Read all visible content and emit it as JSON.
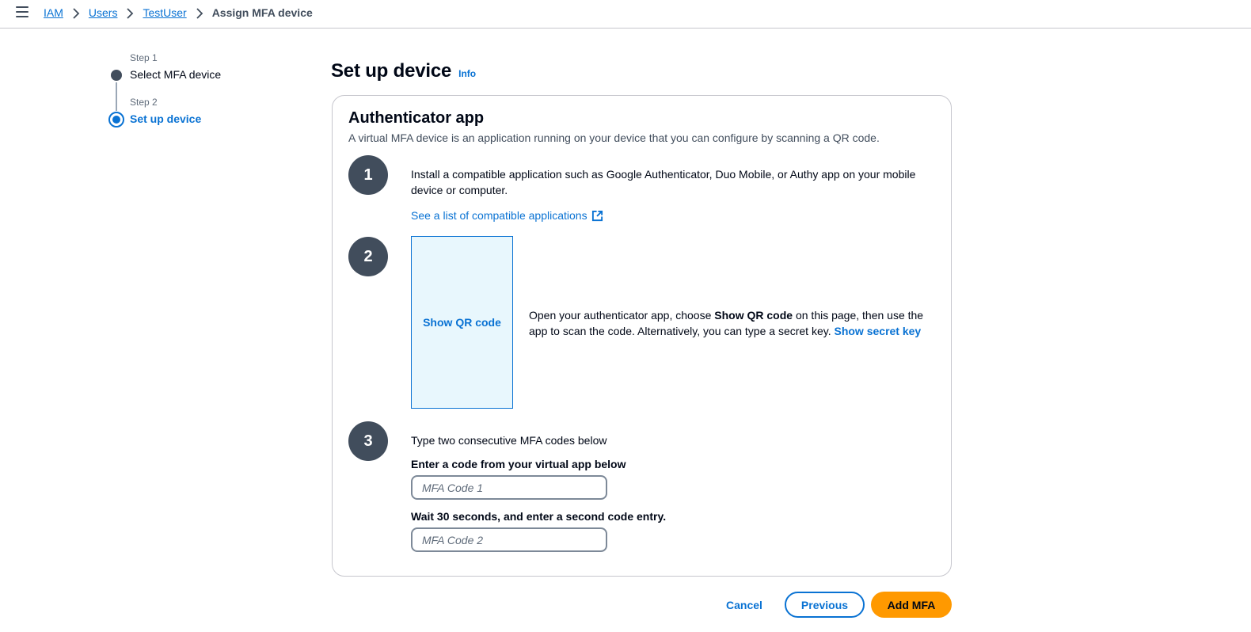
{
  "breadcrumb": {
    "items": [
      "IAM",
      "Users",
      "TestUser"
    ],
    "current": "Assign MFA device"
  },
  "wizard": {
    "steps": [
      {
        "step_label": "Step 1",
        "title": "Select MFA device",
        "status": "completed"
      },
      {
        "step_label": "Step 2",
        "title": "Set up device",
        "status": "active"
      }
    ]
  },
  "page": {
    "title": "Set up device",
    "info_label": "Info"
  },
  "card": {
    "title": "Authenticator app",
    "description": "A virtual MFA device is an application running on your device that you can configure by scanning a QR code.",
    "step1": {
      "number": "1",
      "text": "Install a compatible application such as Google Authenticator, Duo Mobile, or Authy app on your mobile device or computer.",
      "link_label": "See a list of compatible applications"
    },
    "step2": {
      "number": "2",
      "qr_button_label": "Show QR code",
      "text_before": "Open your authenticator app, choose ",
      "text_bold": "Show QR code",
      "text_after": " on this page, then use the app to scan the code. Alternatively, you can type a secret key. ",
      "secret_link_label": "Show secret key"
    },
    "step3": {
      "number": "3",
      "heading": "Type two consecutive MFA codes below",
      "field1_label": "Enter a code from your virtual app below",
      "field1_placeholder": "MFA Code 1",
      "field1_value": "",
      "field2_label": "Wait 30 seconds, and enter a second code entry.",
      "field2_placeholder": "MFA Code 2",
      "field2_value": ""
    }
  },
  "actions": {
    "cancel_label": "Cancel",
    "previous_label": "Previous",
    "submit_label": "Add MFA"
  },
  "colors": {
    "link": "#0972d3",
    "primary_button": "#ff9900",
    "step_number_bg": "#414d5c",
    "qr_box_bg": "#e8f7fd"
  }
}
